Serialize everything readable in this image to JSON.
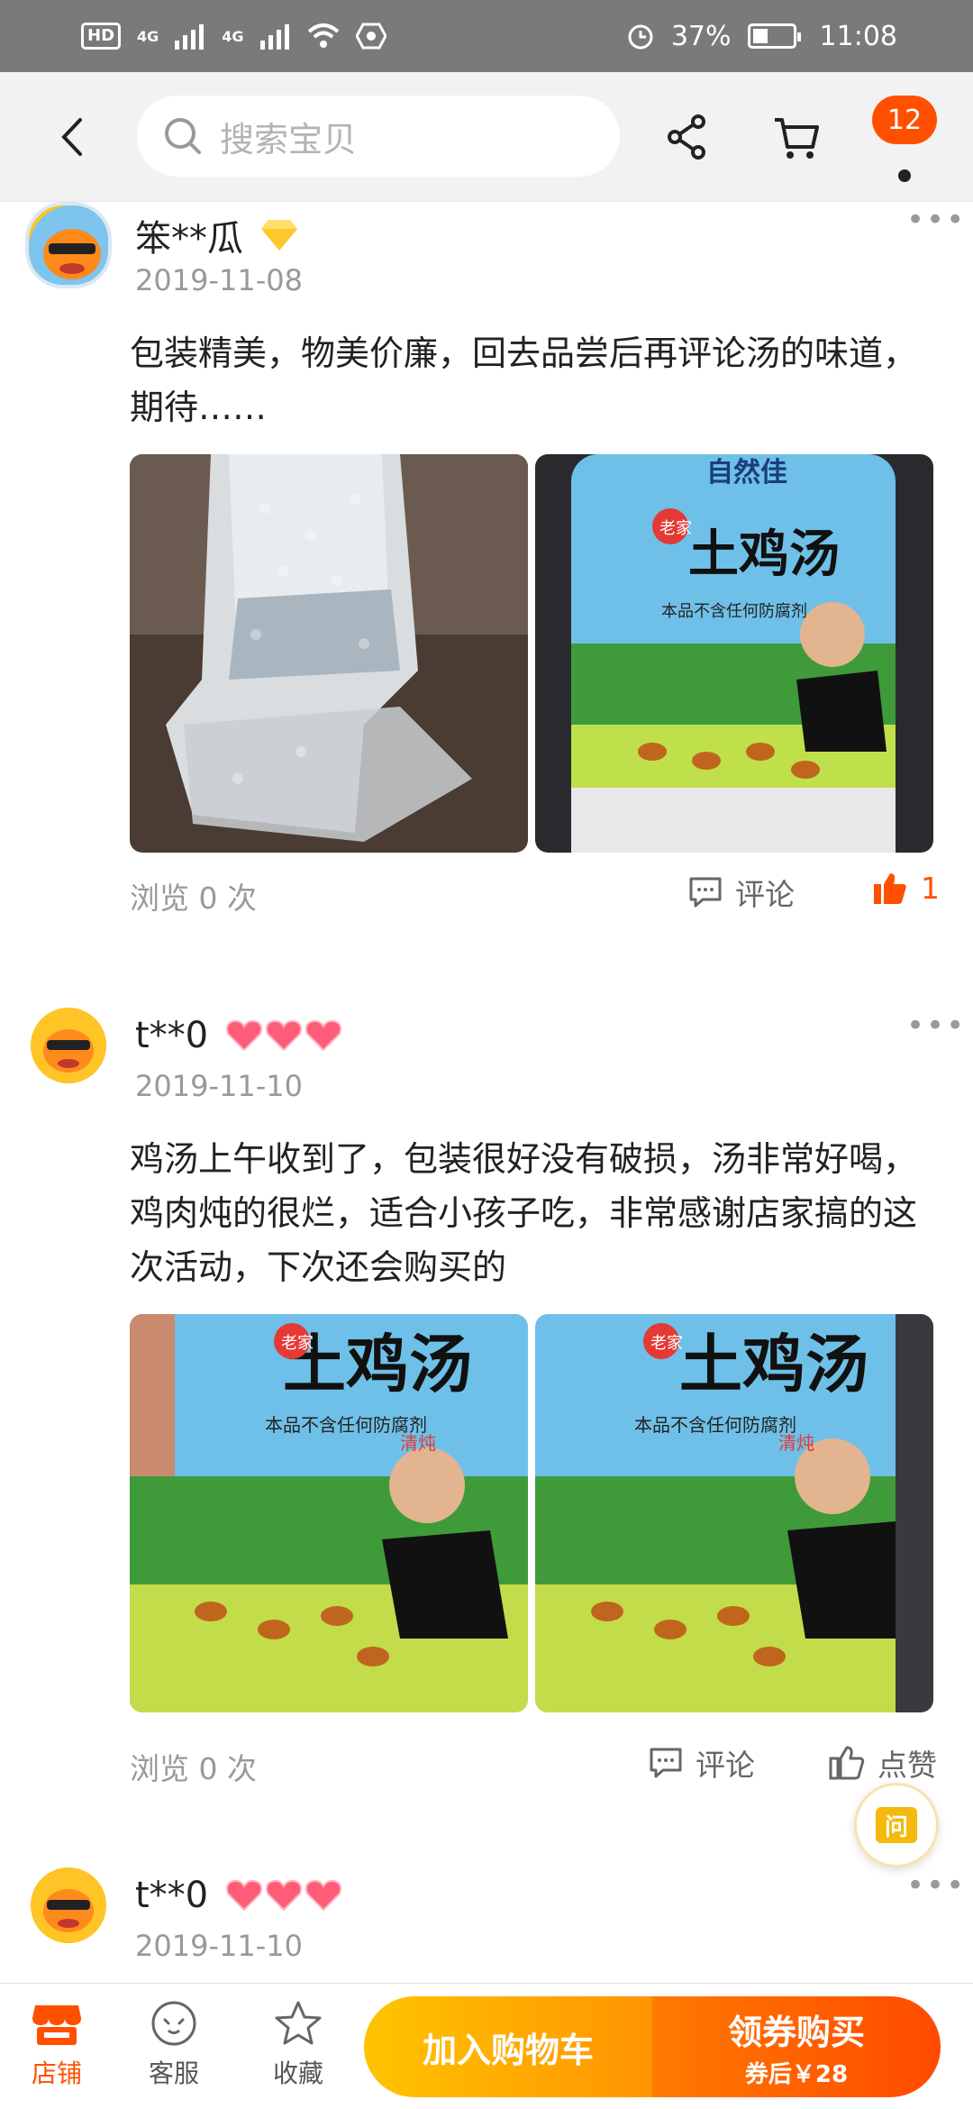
{
  "status_bar": {
    "hd": "HD",
    "signal1": "4G",
    "signal2": "4G",
    "battery": "37%",
    "time": "11:08"
  },
  "header": {
    "search_placeholder": "搜索宝贝",
    "cart_count": "12"
  },
  "reviews": [
    {
      "user": "笨**瓜",
      "date": "2019-11-08",
      "text": "包装精美，物美价廉，回去品尝后再评论汤的味道，期待……",
      "views": "浏览 0 次",
      "comment_label": "评论",
      "like_label": "1",
      "liked": true
    },
    {
      "user": "t**0",
      "date": "2019-11-10",
      "text": "鸡汤上午收到了，包装很好没有破损，汤非常好喝，鸡肉炖的很烂，适合小孩子吃，非常感谢店家搞的这次活动，下次还会购买的",
      "views": "浏览 0 次",
      "comment_label": "评论",
      "like_label": "点赞",
      "liked": false
    },
    {
      "user": "t**0",
      "date": "2019-11-10"
    }
  ],
  "photo_text": {
    "brand": "土鸡汤",
    "tag": "老家",
    "claim": "本品不含任何防腐剂",
    "stew": "清炖",
    "top": "自然佳"
  },
  "ask_button": "问",
  "bottom_bar": {
    "shop": "店铺",
    "service": "客服",
    "favorite": "收藏",
    "add_to_cart": "加入购物车",
    "buy": "领券购买",
    "buy_sub": "券后￥28"
  },
  "colors": {
    "accent": "#ff5000",
    "cart_start": "#ffc400",
    "buy_end": "#ff4a00"
  }
}
